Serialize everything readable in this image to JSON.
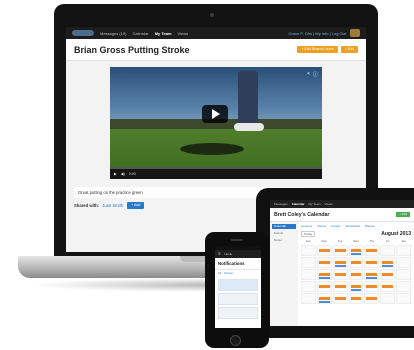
{
  "laptop": {
    "nav": {
      "items": [
        "Messages (19)",
        "Calendar",
        "My Team",
        "Views"
      ],
      "active_index": 2,
      "user_link": "Grace P. Ohs | My Info | Log Out"
    },
    "page_title": "Brian Gross Putting Stroke",
    "header_buttons": [
      "+ Edit Shared Users",
      "+ Edit"
    ],
    "video": {
      "time": "0:00",
      "progress_pct": 0
    },
    "caption": "Great putting on the practice green",
    "shared_with_label": "Shared with:",
    "shared_with_user": "Juan Smith",
    "shared_button": "+ Add"
  },
  "tablet": {
    "nav": [
      "Messages",
      "Calendar",
      "My Team",
      "Views"
    ],
    "active_nav_index": 1,
    "title": "Brett Coley's Calendar",
    "add_button": "+ Add",
    "sidebar": [
      "Calendar",
      "Events",
      "Notes"
    ],
    "filters": [
      "Lessons",
      "Clinics",
      "Camps",
      "Scheduled",
      "Shared"
    ],
    "today_button": "Today",
    "month": "August 2013",
    "weekdays": [
      "Sun",
      "Mon",
      "Tue",
      "Wed",
      "Thu",
      "Fri",
      "Sat"
    ],
    "colors": {
      "event_orange": "#f08a24",
      "event_blue": "#4a90d9"
    }
  },
  "phone": {
    "bar_label": "Home",
    "title": "Notifications",
    "tabs": [
      "All",
      "Unread"
    ]
  }
}
